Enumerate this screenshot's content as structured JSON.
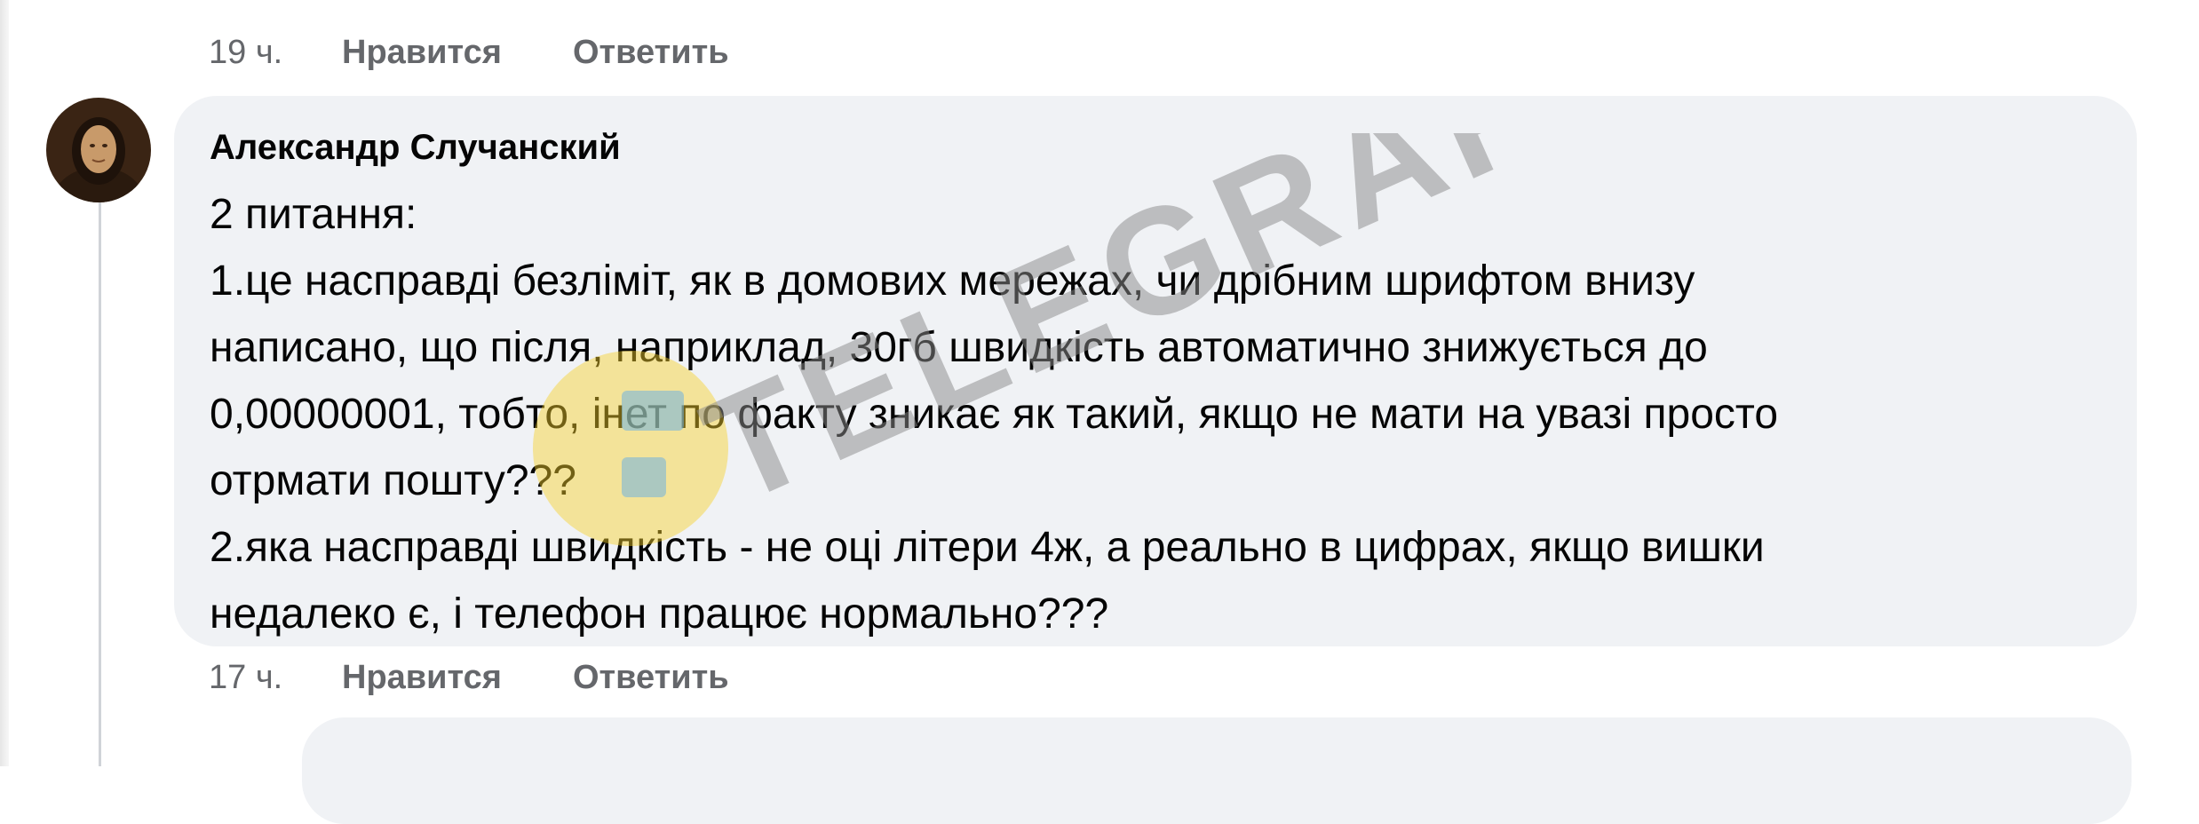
{
  "previous_comment": {
    "time": "19 ч.",
    "like_label": "Нравится",
    "reply_label": "Ответить"
  },
  "comment": {
    "author": "Александр Случанский",
    "avatar_icon": "user-avatar",
    "lines": [
      "2 питання:",
      "1.це насправді безліміт, як в домових мережах, чи дрібним шрифтом внизу",
      "написано, що після, наприклад, 30гб швидкість автоматично знижується до",
      "0,00000001, тобто, інет по факту зникає як такий, якщо не мати на увазі просто",
      "отрмати пошту???",
      "2.яка насправді швидкість - не оці літери 4ж, а реально в цифрах, якщо вишки",
      "недалеко є, і телефон працює нормально???"
    ],
    "time": "17 ч.",
    "like_label": "Нравится",
    "reply_label": "Ответить"
  },
  "watermark": {
    "text": "TELEGRAF",
    "logo_icon": "telegraf-logo-icon"
  },
  "colors": {
    "bubble": "#f0f2f5",
    "meta_text": "#65676b",
    "text": "#050505",
    "watermark_logo": "#f6d02a"
  }
}
